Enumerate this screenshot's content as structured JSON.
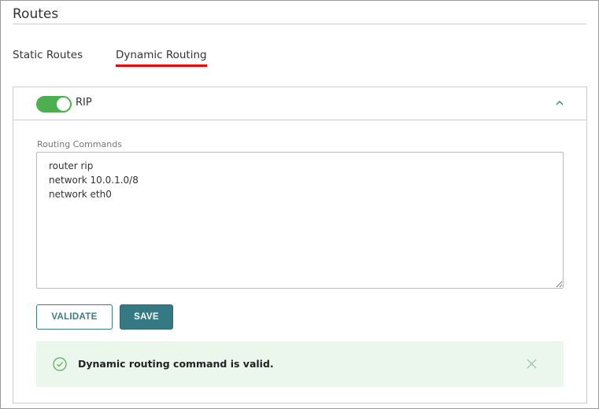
{
  "page": {
    "title": "Routes"
  },
  "tabs": [
    {
      "label": "Static Routes",
      "active": false
    },
    {
      "label": "Dynamic Routing",
      "active": true
    }
  ],
  "rip": {
    "label": "RIP",
    "enabled": true
  },
  "routing_commands": {
    "label": "Routing Commands",
    "value": "router rip\nnetwork 10.0.1.0/8\nnetwork eth0"
  },
  "buttons": {
    "validate": "VALIDATE",
    "save": "SAVE"
  },
  "alert": {
    "message": "Dynamic routing command is valid."
  },
  "colors": {
    "accent": "#347983",
    "tab_underline": "#e00000",
    "toggle_on": "#4caf50",
    "success_bg": "#ebf6ec"
  }
}
